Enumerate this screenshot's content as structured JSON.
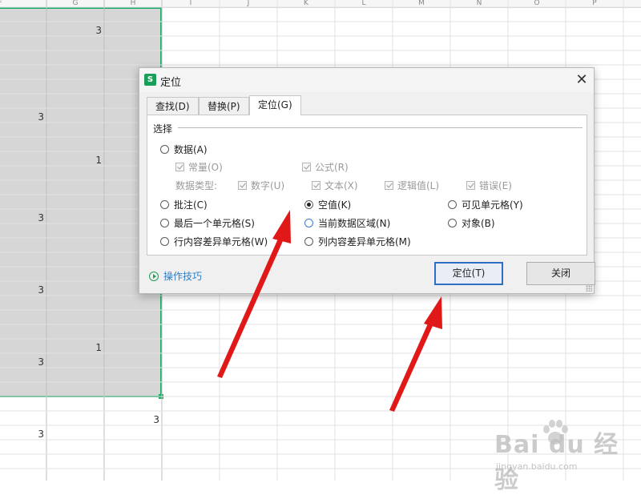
{
  "spreadsheet": {
    "column_headers": [
      "F",
      "G",
      "H",
      "I",
      "J",
      "K",
      "L",
      "M",
      "N",
      "O",
      "P"
    ],
    "cells": [
      {
        "value": "3"
      },
      {
        "value": "3"
      },
      {
        "value": "1"
      },
      {
        "value": "3"
      },
      {
        "value": "3"
      },
      {
        "value": "1"
      },
      {
        "value": "3"
      },
      {
        "value": "3"
      },
      {
        "value": "3"
      }
    ],
    "selection_color": "#1faa6a"
  },
  "dialog": {
    "app_icon": "S",
    "title": "定位",
    "close_glyph": "✕",
    "tabs": [
      {
        "label": "查找(D)"
      },
      {
        "label": "替换(P)"
      },
      {
        "label": "定位(G)",
        "active": true
      }
    ],
    "section_label": "选择",
    "options": {
      "data": "数据(A)",
      "constant": "常量(O)",
      "formula": "公式(R)",
      "data_type_label": "数据类型:",
      "number": "数字(U)",
      "text": "文本(X)",
      "logical": "逻辑值(L)",
      "error": "错误(E)",
      "comment": "批注(C)",
      "blank": "空值(K)",
      "visible_cells": "可见单元格(Y)",
      "last_cell": "最后一个单元格(S)",
      "current_region": "当前数据区域(N)",
      "objects": "对象(B)",
      "row_diff": "行内容差异单元格(W)",
      "col_diff": "列内容差异单元格(M)"
    },
    "selected_option": "空值(K)",
    "tips_link": "操作技巧",
    "buttons": {
      "locate": "定位(T)",
      "close": "关闭"
    }
  },
  "watermark": {
    "text": "Bai du 经验",
    "sub": "jingyan.baidu.com"
  },
  "colors": {
    "accent_green": "#1b9e5a",
    "link_blue": "#2f7ec2",
    "primary_border": "#2f6ec4",
    "arrow_red": "#e01818"
  }
}
